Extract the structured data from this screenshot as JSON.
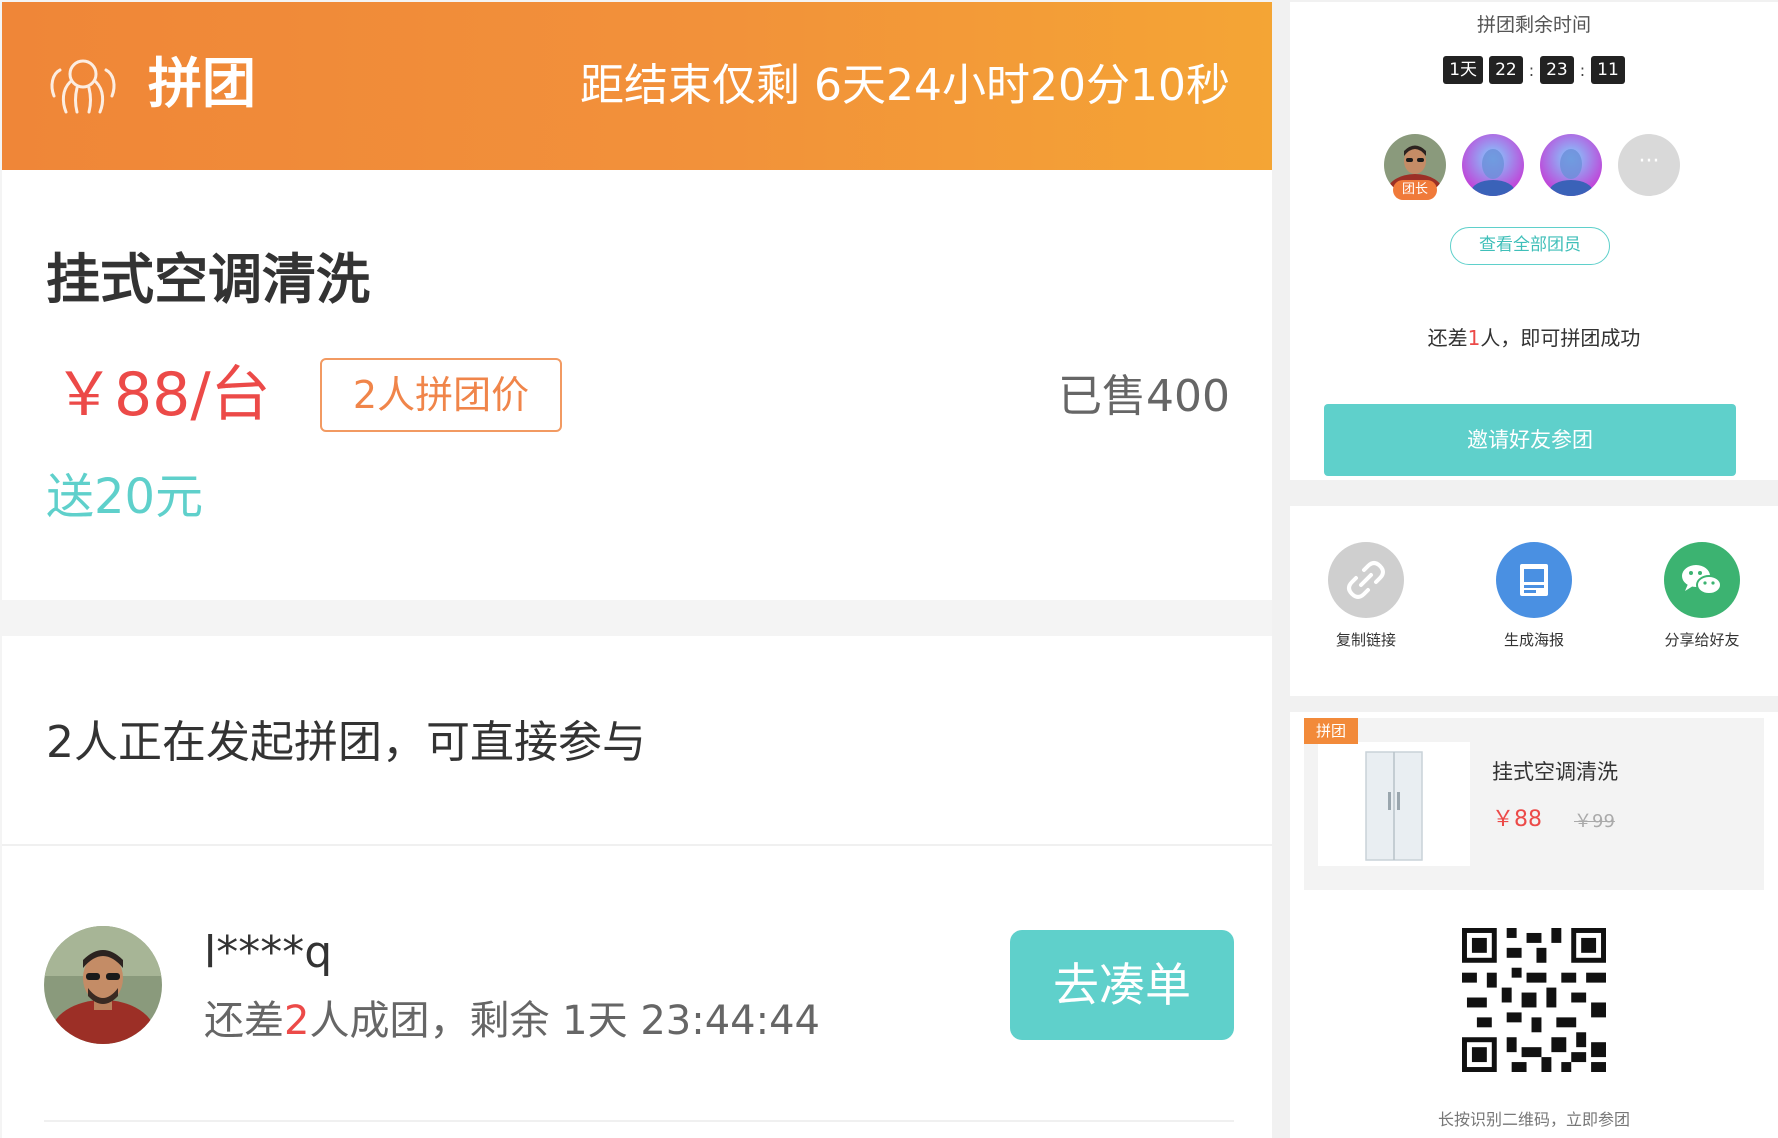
{
  "banner": {
    "title": "拼团",
    "countdown": "距结束仅剩 6天24小时20分10秒",
    "icon": "group-people-icon"
  },
  "product": {
    "title": "挂式空调清洗",
    "price": "￥88/台",
    "group_tag": "2人拼团价",
    "sold": "已售400",
    "bonus": "送20元"
  },
  "join": {
    "heading": "2人正在发起拼团，可直接参与",
    "member": {
      "name": "l****q",
      "status_prefix": "还差",
      "status_count": "2",
      "status_suffix": "人成团，剩余 1天 23:44:44",
      "button": "去凑单"
    }
  },
  "share": {
    "remain_label": "拼团剩余时间",
    "timer": {
      "days": "1天",
      "hours": "22",
      "minutes": "23",
      "seconds": "11"
    },
    "leader_badge": "团长",
    "more": "···",
    "view_all": "查看全部团员",
    "need_prefix": "还差",
    "need_count": "1",
    "need_suffix": "人，即可拼团成功",
    "invite_button": "邀请好友参团"
  },
  "actions": [
    {
      "label": "复制链接",
      "icon": "link-icon",
      "color": "#cfcfcf"
    },
    {
      "label": "生成海报",
      "icon": "poster-icon",
      "color": "#4a90e2"
    },
    {
      "label": "分享给好友",
      "icon": "wechat-icon",
      "color": "#3cb371"
    }
  ],
  "poster": {
    "tag": "拼团",
    "title": "挂式空调清洗",
    "price": "￥88",
    "original_price": "￥99",
    "scan_text": "长按识别二维码，立即参团"
  },
  "colors": {
    "accent": "#5fd0cb",
    "price_red": "#ec4a48",
    "banner_orange": "#f2913a"
  }
}
